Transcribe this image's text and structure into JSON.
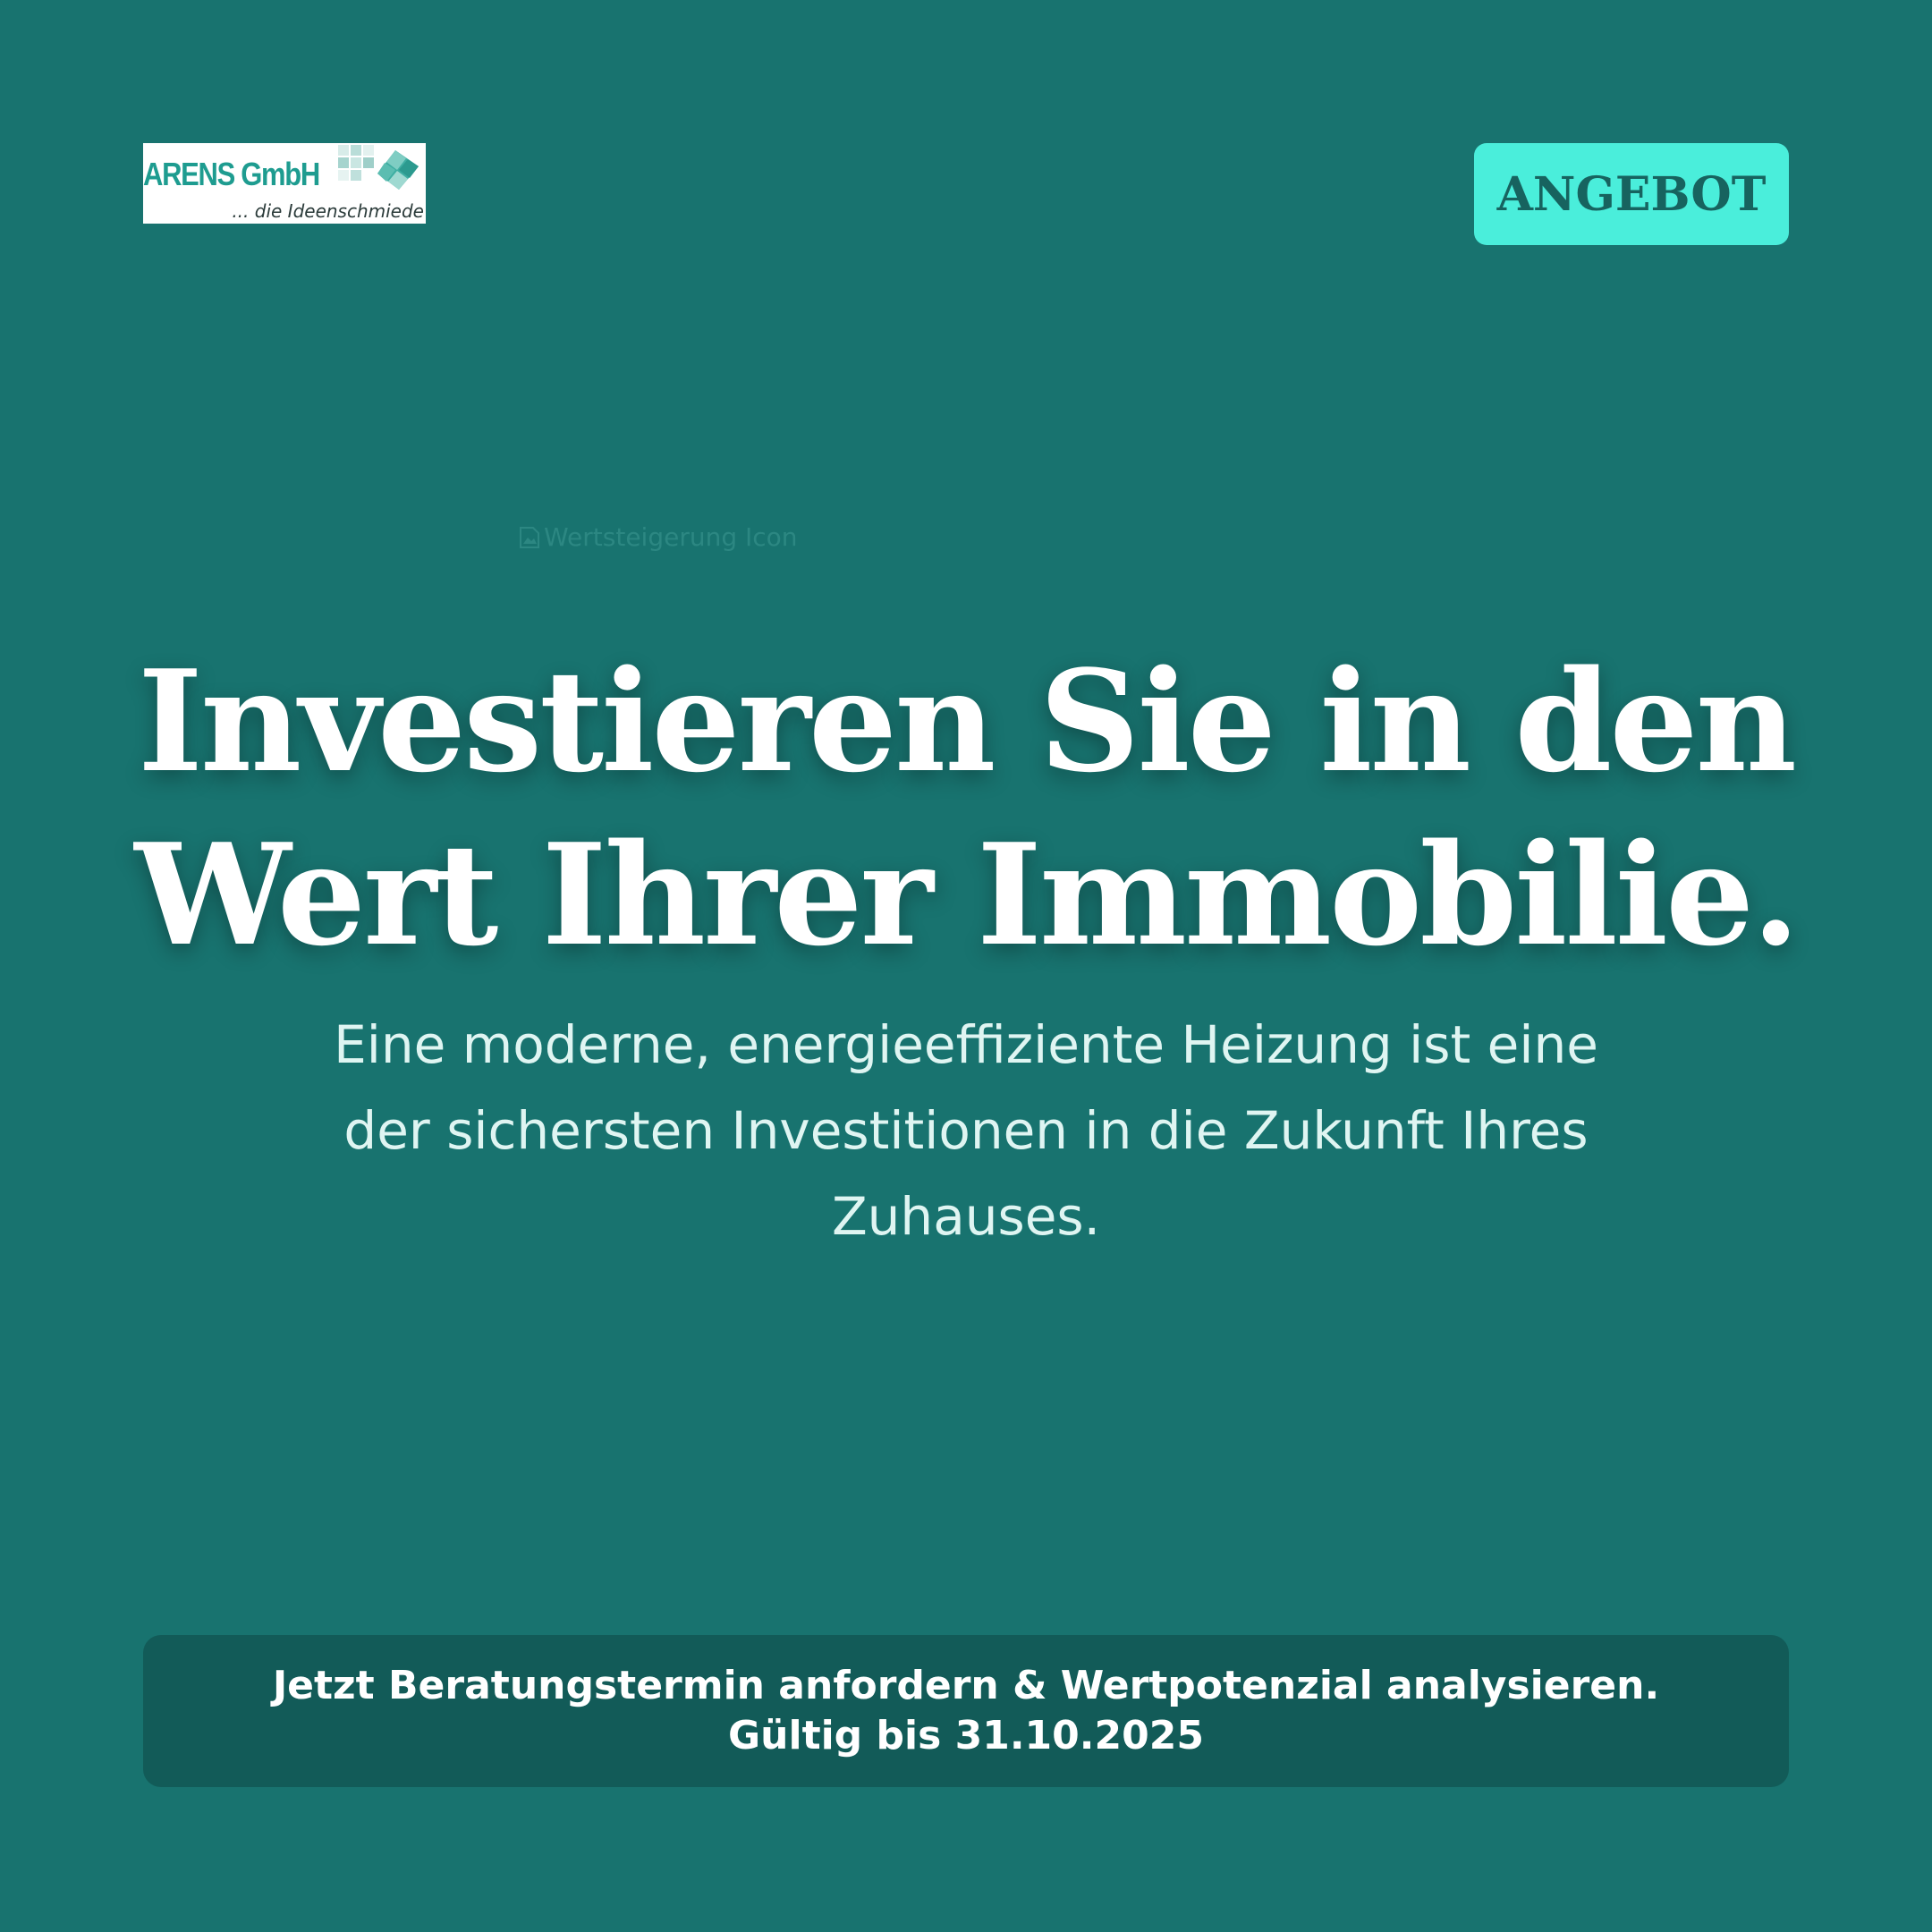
{
  "header": {
    "logo": {
      "name": "ARENS GmbH",
      "tagline": "... die Ideenschmiede"
    },
    "angebot_label": "ANGEBOT"
  },
  "hero": {
    "image_alt": "Wertsteigerung Icon",
    "headline_line1": "Investieren Sie in den",
    "headline_line2": "Wert Ihrer Immobilie.",
    "subtext": "Eine moderne, energieeffiziente Heizung ist eine der sichersten Investitionen in die Zukunft Ihres Zuhauses."
  },
  "cta": {
    "text": "Jetzt Beratungstermin anfordern & Wertpotenzial analysieren. Gültig bis 31.10.2025"
  },
  "colors": {
    "background": "#18736f",
    "accent": "#4aeedb",
    "accent_text": "#17635f",
    "cta_background": "#125b58",
    "logo_green": "#1e9c90"
  },
  "icons": {
    "broken_image": "broken-image-icon",
    "logo_graphic": "tile-diamond-icon"
  }
}
